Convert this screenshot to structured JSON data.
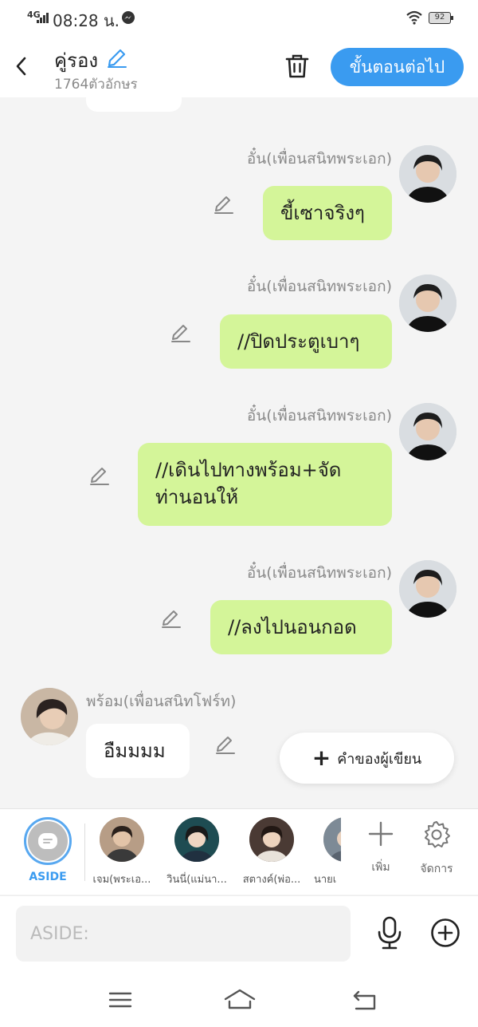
{
  "status_bar": {
    "network": "4G",
    "time": "08:28 น.",
    "battery": "92"
  },
  "header": {
    "title": "คู่รอง",
    "char_count": "1764ตัวอักษร",
    "next_label": "ขั้นตอนต่อไป"
  },
  "messages": [
    {
      "sender": "อั๋น(เพื่อนสนิทพระเอก)",
      "text": "ขี้เซาจริงๆ"
    },
    {
      "sender": "อั๋น(เพื่อนสนิทพระเอก)",
      "text": "//ปิดประตูเบาๆ"
    },
    {
      "sender": "อั๋น(เพื่อนสนิทพระเอก)",
      "text": "//เดินไปทางพร้อม+จัด\nท่านอนให้"
    },
    {
      "sender": "อั๋น(เพื่อนสนิทพระเอก)",
      "text": "//ลงไปนอนกอด"
    },
    {
      "sender": "พร้อม(เพื่อนสนิทโฟร์ท)",
      "text": "อืมมมม"
    }
  ],
  "author_note_label": "คำของผู้เขียน",
  "char_bar": {
    "aside_label": "ASIDE",
    "characters": [
      {
        "label": "เจม(พระเอ..."
      },
      {
        "label": "วินนี่(แม่นา..."
      },
      {
        "label": "สตางค์(พ่อ..."
      },
      {
        "label": "นายเ"
      }
    ],
    "add_label": "เพิ่ม",
    "manage_label": "จัดการ"
  },
  "input": {
    "placeholder": "ASIDE:"
  },
  "colors": {
    "accent": "#3a9bf0",
    "my_bubble": "#d4f599",
    "their_bubble": "#ffffff",
    "background": "#f4f4f4"
  },
  "icons": {
    "back": "chevron-left-icon",
    "edit": "pencil-icon",
    "trash": "trash-icon",
    "mic": "microphone-icon",
    "add": "plus-circle-icon",
    "settings": "gear-icon"
  }
}
